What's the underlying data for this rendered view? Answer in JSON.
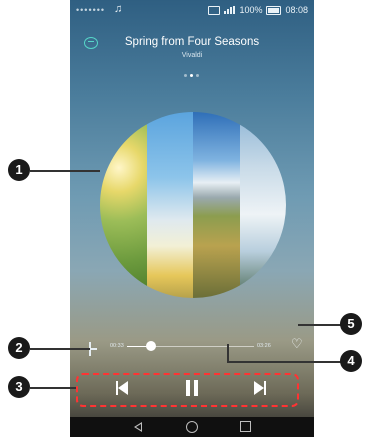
{
  "status_bar": {
    "carrier_blur": "•••••••",
    "note_icon": "♫",
    "battery": "100%",
    "time": "08:08"
  },
  "header": {
    "title": "Spring from Four Seasons",
    "artist": "Vivaldi"
  },
  "player": {
    "elapsed": "00:33",
    "total": "03:26",
    "progress_fraction": 0.19
  },
  "callouts": [
    "1",
    "2",
    "3",
    "4",
    "5"
  ],
  "icons": {
    "header": "mini-player-icon",
    "add": "add-icon",
    "favorite": "heart-icon",
    "previous": "skip-previous-icon",
    "pause": "pause-icon",
    "next": "skip-next-icon",
    "back": "nav-back-icon",
    "home": "nav-home-icon",
    "recent": "nav-recent-icon"
  },
  "colors": {
    "callout_box": "#ff3333",
    "accent": "#56d6c8",
    "callout_bg": "#1a1a1a"
  }
}
